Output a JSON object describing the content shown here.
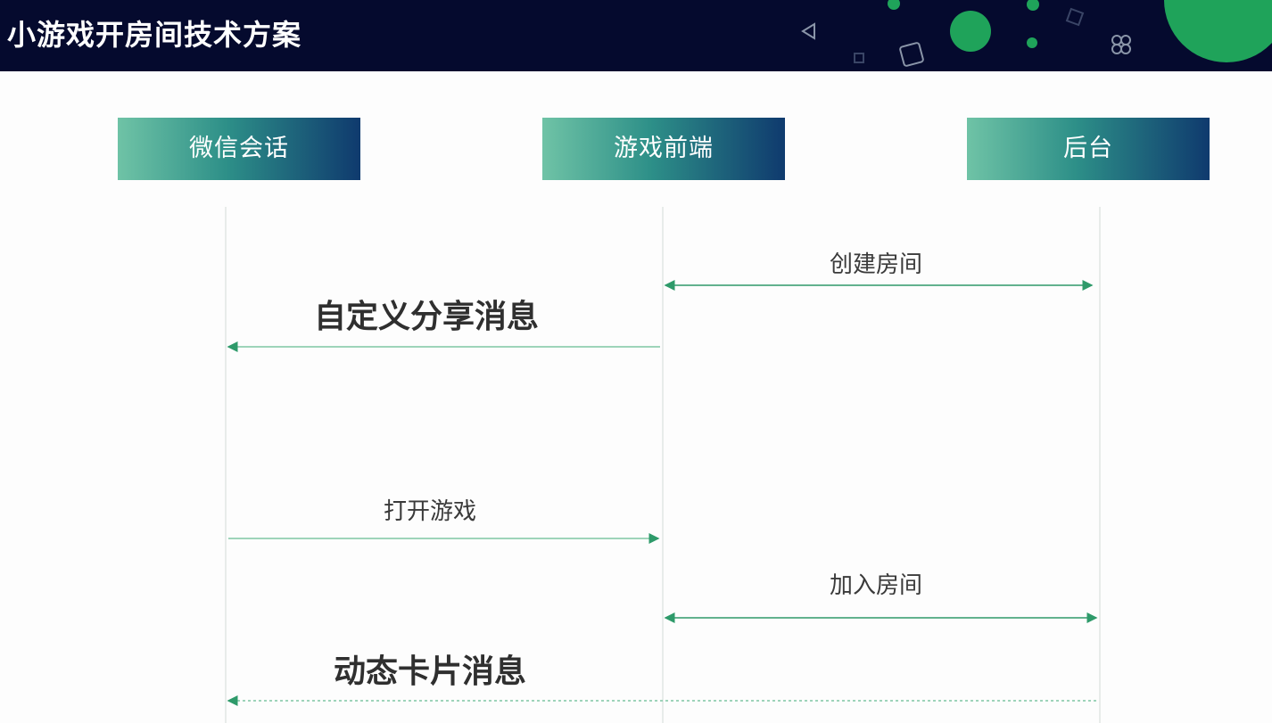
{
  "header": {
    "title": "小游戏开房间技术方案"
  },
  "actors": {
    "wechat": "微信会话",
    "frontend": "游戏前端",
    "backend": "后台"
  },
  "messages": {
    "create_room": "创建房间",
    "custom_share": "自定义分享消息",
    "open_game": "打开游戏",
    "join_room": "加入房间",
    "dynamic_card": "动态卡片消息"
  },
  "colors": {
    "header_bg": "#050a2e",
    "accent_green": "#1fa35a",
    "arrow_green": "#2e9a6a",
    "actor_gradient_start": "#6fc3a6",
    "actor_gradient_end": "#0f3a6e"
  }
}
